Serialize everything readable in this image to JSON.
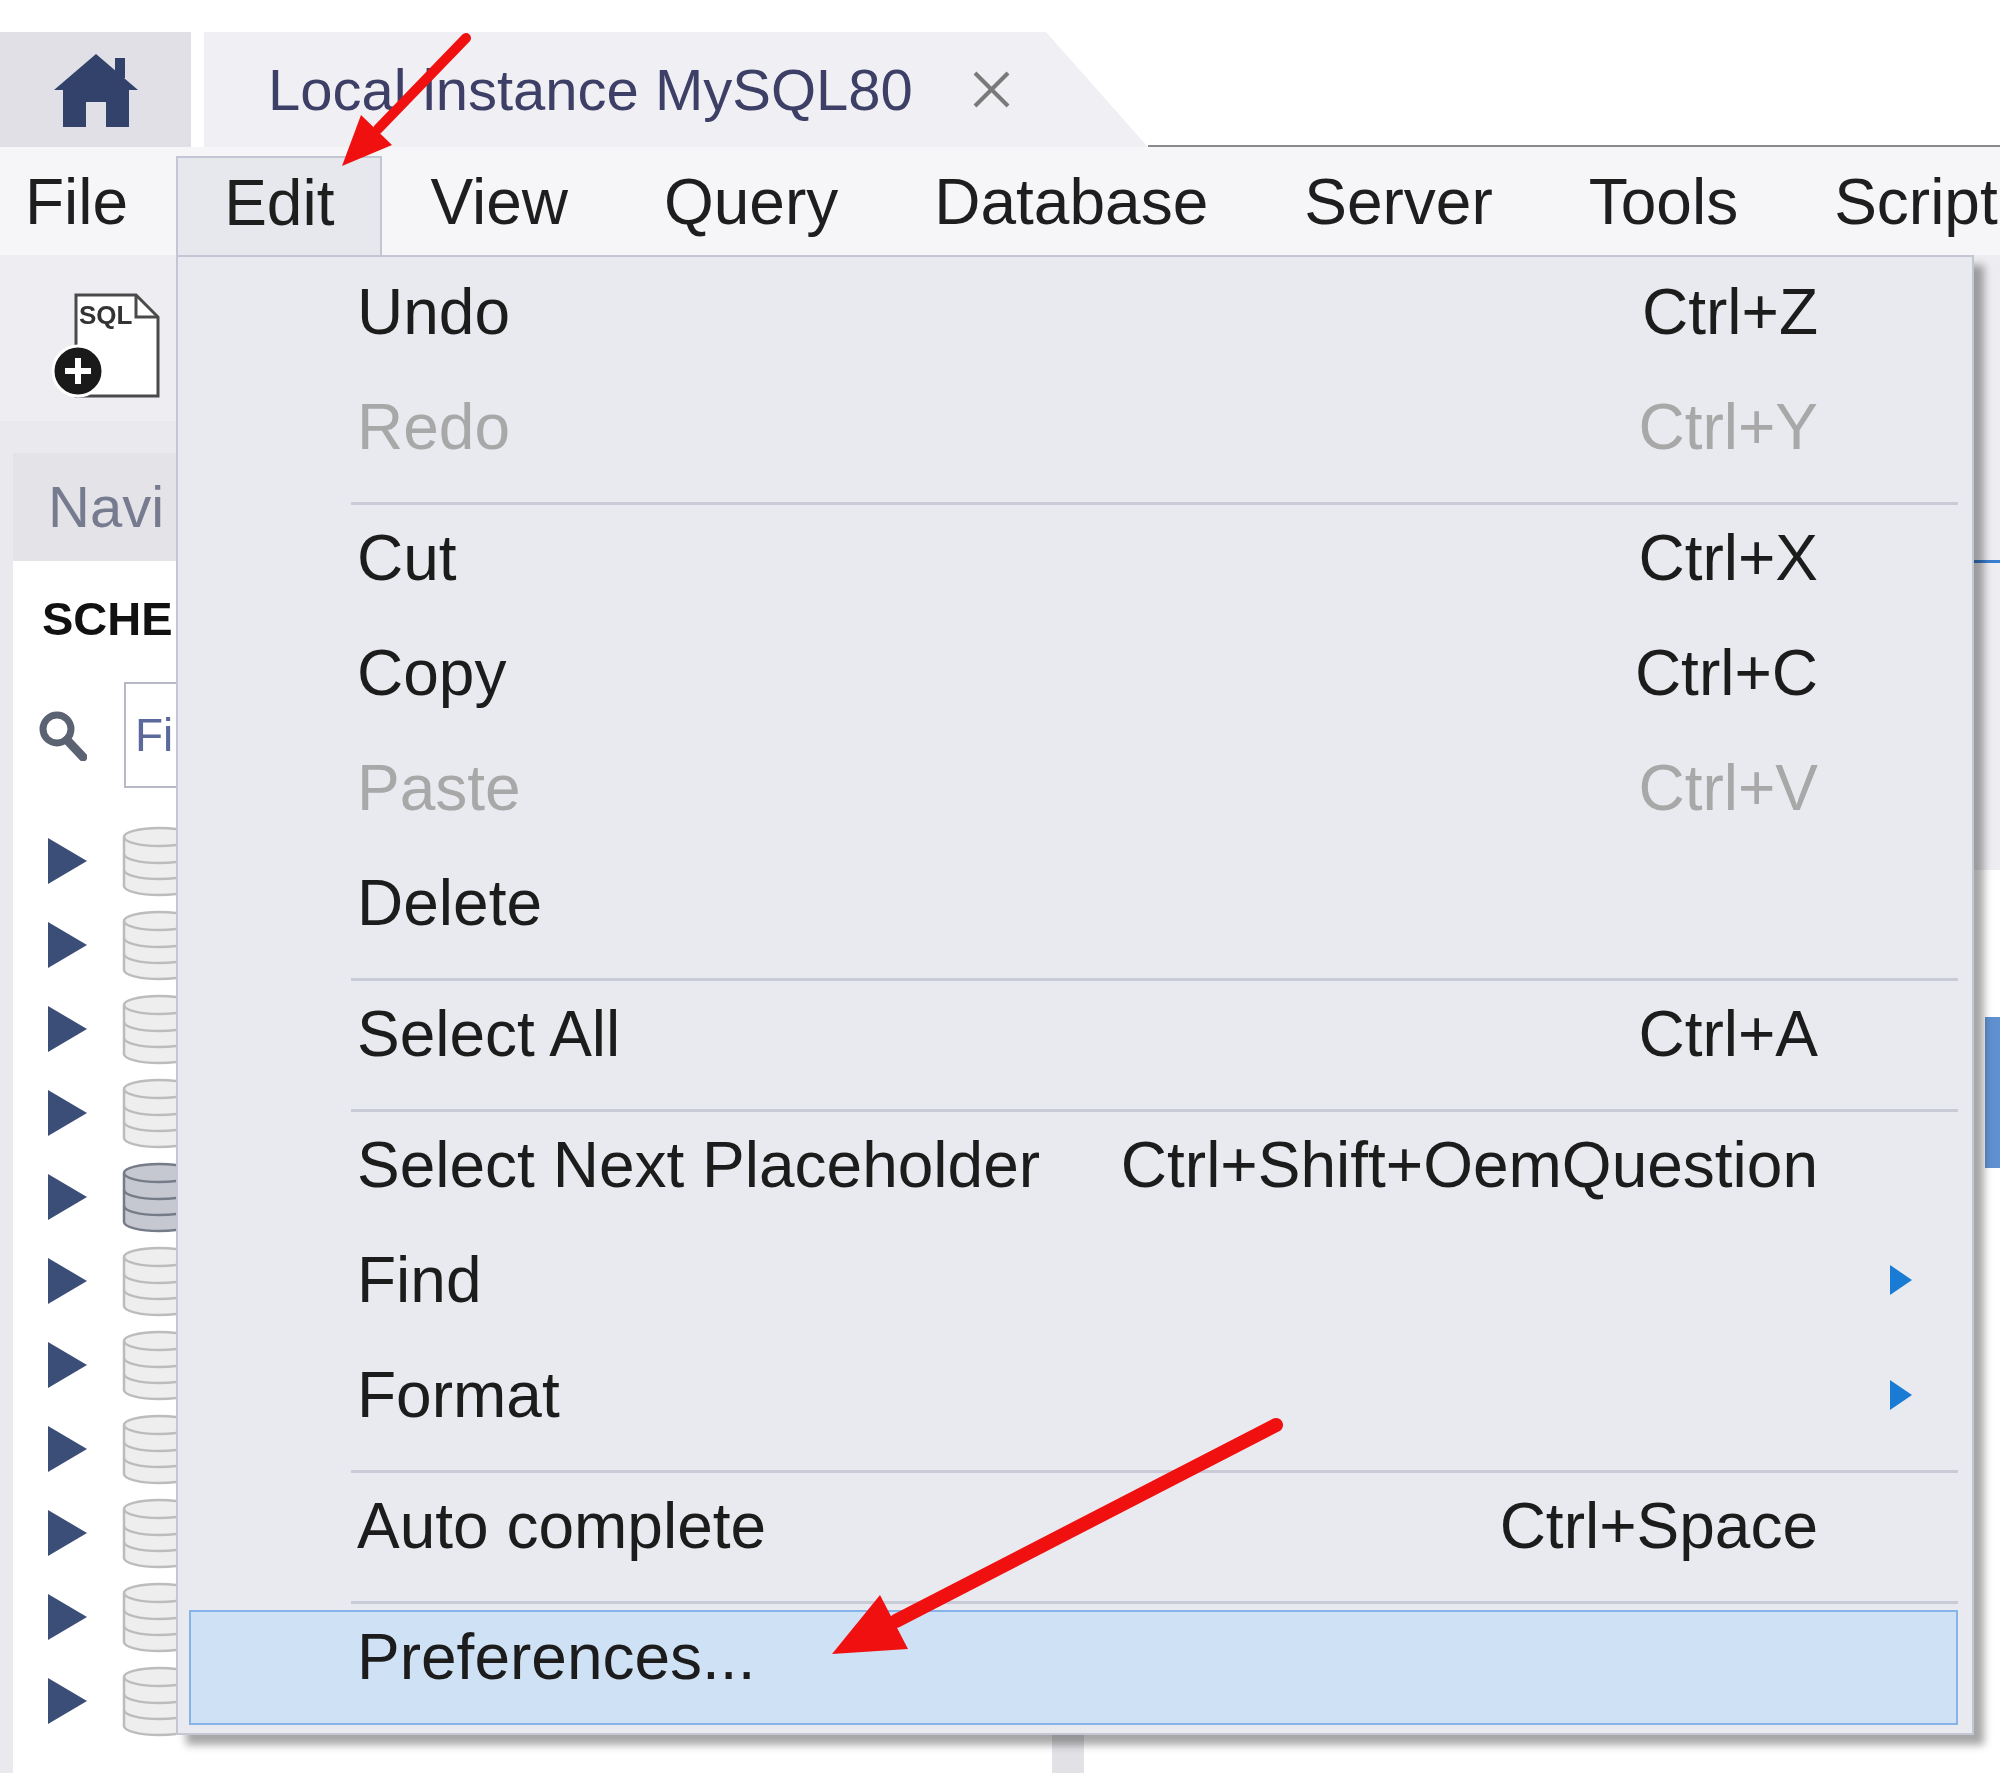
{
  "tabs": [
    {
      "kind": "home",
      "selected": false
    },
    {
      "kind": "connection",
      "label": "Local instance MySQL80",
      "selected": true
    }
  ],
  "menu_bar": [
    {
      "label": "File",
      "selected": false
    },
    {
      "label": "Edit",
      "selected": true
    },
    {
      "label": "View",
      "selected": false
    },
    {
      "label": "Query",
      "selected": false
    },
    {
      "label": "Database",
      "selected": false
    },
    {
      "label": "Server",
      "selected": false
    },
    {
      "label": "Tools",
      "selected": false
    },
    {
      "label": "Script",
      "selected": false
    }
  ],
  "toolbar": {
    "new_sql_button": {
      "icon_text": "SQL"
    }
  },
  "navigator": {
    "header": "Navi",
    "section_title": "SCHE",
    "filter": {
      "placeholder": "Fi"
    },
    "schemas": [
      {
        "expanded": false,
        "active": false
      },
      {
        "expanded": false,
        "active": false
      },
      {
        "expanded": false,
        "active": false
      },
      {
        "expanded": false,
        "active": false
      },
      {
        "expanded": false,
        "active": true
      },
      {
        "expanded": false,
        "active": false
      },
      {
        "expanded": false,
        "active": false
      },
      {
        "expanded": false,
        "active": false
      },
      {
        "expanded": false,
        "active": false
      },
      {
        "expanded": false,
        "active": false
      },
      {
        "expanded": false,
        "active": false
      }
    ]
  },
  "edit_menu": {
    "items": [
      {
        "kind": "item",
        "label": "Undo",
        "shortcut": "Ctrl+Z",
        "disabled": false,
        "submenu": false,
        "selected": false
      },
      {
        "kind": "item",
        "label": "Redo",
        "shortcut": "Ctrl+Y",
        "disabled": true,
        "submenu": false,
        "selected": false
      },
      {
        "kind": "separator"
      },
      {
        "kind": "item",
        "label": "Cut",
        "shortcut": "Ctrl+X",
        "disabled": false,
        "submenu": false,
        "selected": false
      },
      {
        "kind": "item",
        "label": "Copy",
        "shortcut": "Ctrl+C",
        "disabled": false,
        "submenu": false,
        "selected": false
      },
      {
        "kind": "item",
        "label": "Paste",
        "shortcut": "Ctrl+V",
        "disabled": true,
        "submenu": false,
        "selected": false
      },
      {
        "kind": "item",
        "label": "Delete",
        "disabled": false,
        "submenu": false,
        "selected": false
      },
      {
        "kind": "separator"
      },
      {
        "kind": "item",
        "label": "Select All",
        "shortcut": "Ctrl+A",
        "disabled": false,
        "submenu": false,
        "selected": false
      },
      {
        "kind": "separator"
      },
      {
        "kind": "item",
        "label": "Select Next Placeholder",
        "shortcut": "Ctrl+Shift+OemQuestion",
        "disabled": false,
        "submenu": false,
        "selected": false
      },
      {
        "kind": "item",
        "label": "Find",
        "disabled": false,
        "submenu": true,
        "selected": false
      },
      {
        "kind": "item",
        "label": "Format",
        "disabled": false,
        "submenu": true,
        "selected": false
      },
      {
        "kind": "separator"
      },
      {
        "kind": "item",
        "label": "Auto complete",
        "shortcut": "Ctrl+Space",
        "disabled": false,
        "submenu": false,
        "selected": false
      },
      {
        "kind": "separator"
      },
      {
        "kind": "item",
        "label": "Preferences...",
        "disabled": false,
        "submenu": false,
        "selected": true
      }
    ]
  }
}
